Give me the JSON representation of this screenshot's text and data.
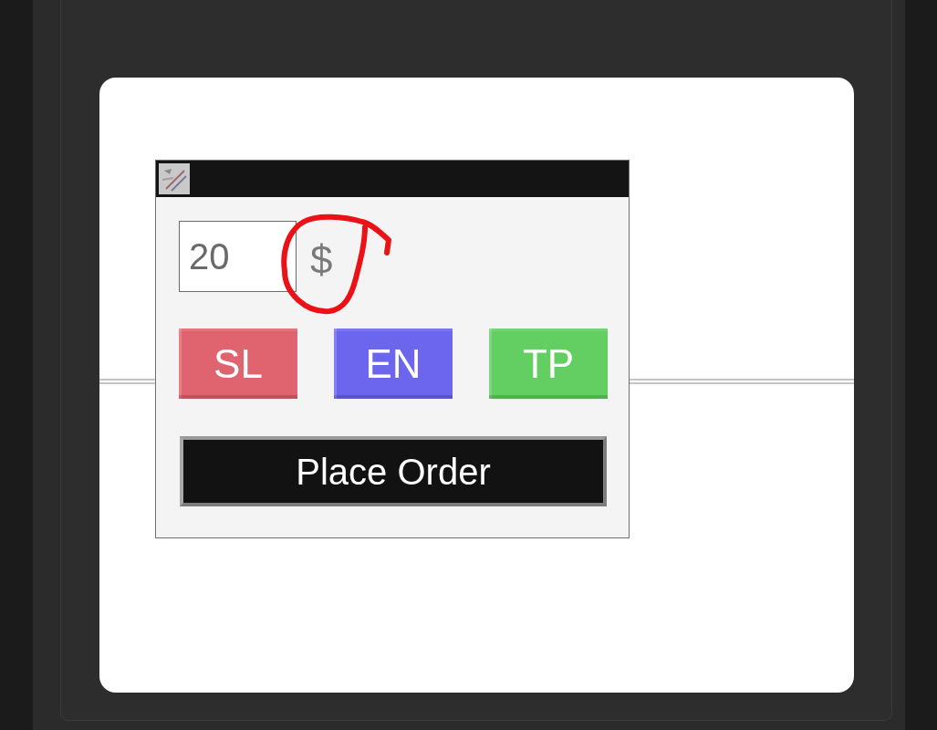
{
  "window": {
    "amount_field": {
      "value": "20"
    },
    "currency_label": {
      "text": "$",
      "circled": true
    },
    "price_buttons": [
      {
        "label": "SL",
        "color": "#e0646f"
      },
      {
        "label": "EN",
        "color": "#6c66ee"
      },
      {
        "label": "TP",
        "color": "#63cf63"
      }
    ],
    "submit_button": {
      "label": "Place Order"
    }
  }
}
